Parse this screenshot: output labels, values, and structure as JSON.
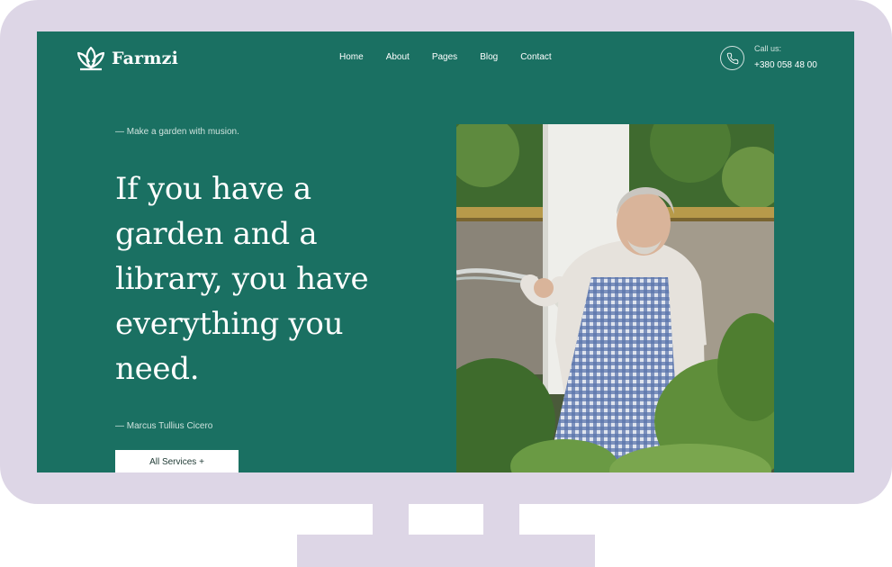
{
  "brand": {
    "name": "Farmzi",
    "logo_icon": "lotus-icon"
  },
  "nav": {
    "items": [
      {
        "label": "Home"
      },
      {
        "label": "About"
      },
      {
        "label": "Pages"
      },
      {
        "label": "Blog"
      },
      {
        "label": "Contact"
      }
    ]
  },
  "contact": {
    "label": "Call us:",
    "phone": "+380 058 48 00",
    "icon": "phone-icon"
  },
  "hero": {
    "tagline": "— Make a garden with musion.",
    "headline": "If you have a garden and a library, you have everything you need.",
    "author": "— Marcus Tullius Cicero",
    "cta_label": "All Services +",
    "image": "gardener-watering-plants-photo"
  },
  "colors": {
    "screen_bg": "#1a7062",
    "monitor_frame": "#ddd6e6",
    "text_light": "#ffffff",
    "text_muted": "#cfe3de"
  }
}
